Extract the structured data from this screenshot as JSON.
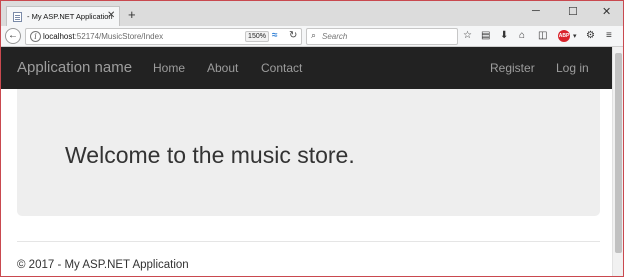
{
  "browser": {
    "tab": {
      "title": "- My ASP.NET Application",
      "close": "✕"
    },
    "new_tab": "+",
    "window_controls": {
      "minimize": "─",
      "maximize": "☐",
      "close": "✕"
    },
    "toolbar": {
      "back": "←",
      "url_host": "localhost",
      "url_path": ":52174/MusicStore/Index",
      "zoom": "150%",
      "search_placeholder": "Search"
    }
  },
  "page": {
    "navbar": {
      "brand": "Application name",
      "links": [
        "Home",
        "About",
        "Contact"
      ],
      "right_links": [
        "Register",
        "Log in"
      ]
    },
    "jumbotron": {
      "heading": "Welcome to the music store."
    },
    "footer": {
      "text": "© 2017 - My ASP.NET Application"
    }
  },
  "colors": {
    "navbar_bg": "#222222",
    "navbar_text": "#9d9d9d",
    "jumbotron_bg": "#eeeeee",
    "window_border": "#c9494f"
  }
}
